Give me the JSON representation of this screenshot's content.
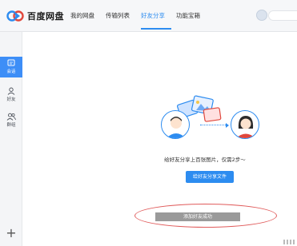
{
  "app": {
    "logo_text": "百度网盘"
  },
  "nav": {
    "tabs": [
      {
        "label": "我的网盘",
        "active": false
      },
      {
        "label": "传输列表",
        "active": false
      },
      {
        "label": "好友分享",
        "active": true
      },
      {
        "label": "功能宝箱",
        "active": false
      }
    ]
  },
  "sidebar": {
    "items": [
      {
        "label": "会话",
        "icon": "chat-icon",
        "active": true
      },
      {
        "label": "好友",
        "icon": "person-icon",
        "active": false
      },
      {
        "label": "群组",
        "icon": "group-icon",
        "active": false
      }
    ],
    "add_icon": "plus-icon"
  },
  "main": {
    "hint": "给好友分享上百张图片，仅需2步～",
    "share_button_label": "给好友分享文件",
    "toast": "添加好友成功"
  },
  "colors": {
    "accent": "#2d8cf0",
    "sidebar_active": "#3d8ef7",
    "annotation": "#e05a5a"
  }
}
